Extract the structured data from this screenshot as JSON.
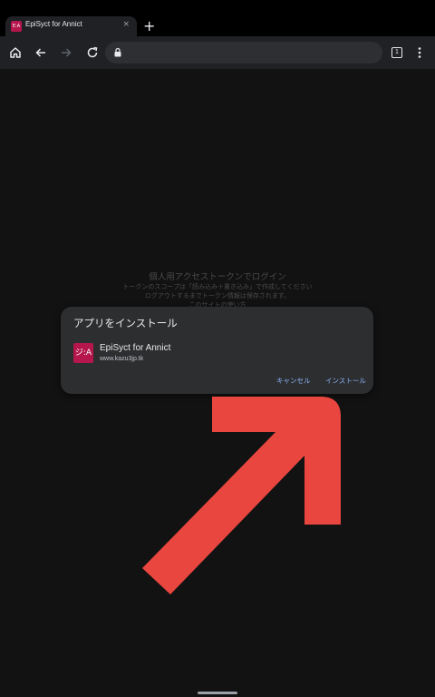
{
  "tab": {
    "favicon_text": "E:A",
    "title": "EpiSyct for Annict",
    "close_glyph": "×"
  },
  "new_tab_glyph": "+",
  "toolbar": {
    "icons": [
      "home-icon",
      "back-icon",
      "forward-icon",
      "reload-icon",
      "lock-icon",
      "star-icon",
      "download-icon",
      "tab-count-icon",
      "more-vert-icon"
    ],
    "tab_count": "1"
  },
  "background": {
    "heading": "個人用アクセストークンでログイン",
    "line1": "トークンのスコープは「読み込み＋書き込み」で作成してください",
    "line2": "ログアウトするまでトークン情報は保存されます。",
    "line3": "このサイトの使い方"
  },
  "dialog": {
    "title": "アプリをインストール",
    "app_icon_text": "ジ:A",
    "app_name": "EpiSyct for Annict",
    "app_url": "www.kazu3jp.tk",
    "cancel_label": "キャンセル",
    "install_label": "インストール"
  },
  "colors": {
    "accent": "#8ab4f8",
    "brand": "#b5174d",
    "arrow": "#e8463f",
    "dialog_bg": "#2d2e30",
    "page_bg": "#121212"
  }
}
